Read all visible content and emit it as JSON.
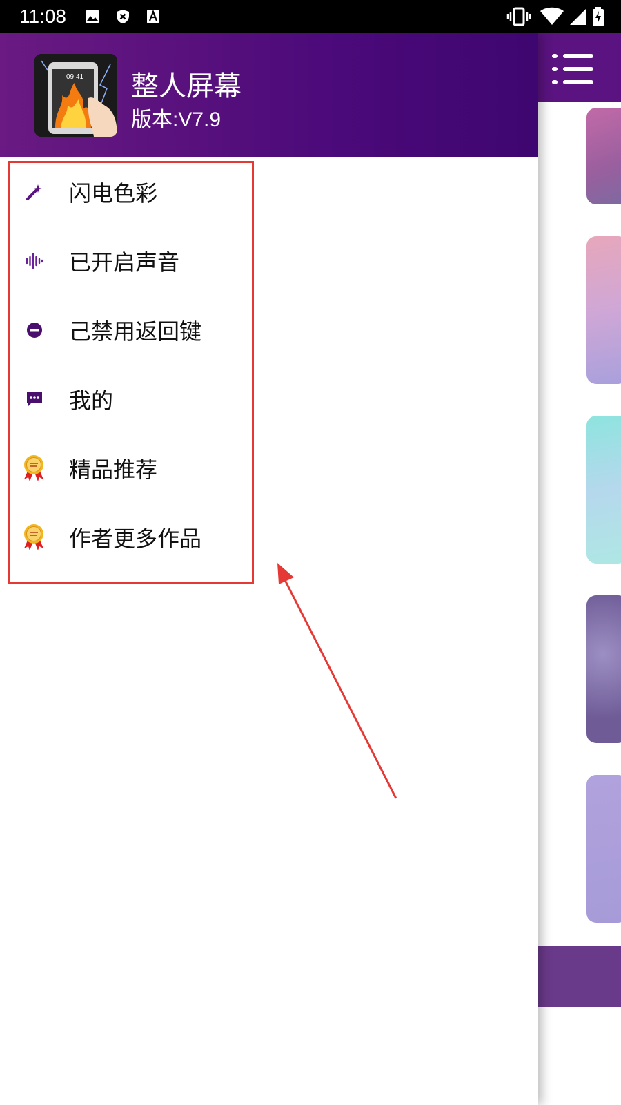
{
  "status_bar": {
    "time": "11:08",
    "icons_left": [
      "image-icon",
      "shield-x-icon",
      "font-a-icon"
    ],
    "icons_right": [
      "vibrate-icon",
      "wifi-icon",
      "signal-icon",
      "battery-charging-icon"
    ]
  },
  "drawer": {
    "header": {
      "title": "整人屏幕",
      "version": "版本:V7.9",
      "gradient": [
        "#6a1a82",
        "#3e0670"
      ]
    },
    "items": [
      {
        "label": "闪电色彩",
        "icon": "magic-wand-icon"
      },
      {
        "label": "已开启声音",
        "icon": "sound-wave-icon"
      },
      {
        "label": "己禁用返回键",
        "icon": "minus-circle-icon"
      },
      {
        "label": "我的",
        "icon": "chat-bubble-icon"
      },
      {
        "label": "精品推荐",
        "icon": "award-badge-icon"
      },
      {
        "label": "作者更多作品",
        "icon": "award-badge-icon"
      }
    ]
  },
  "colors": {
    "accent": "#5a1380",
    "annotation": "#e53935"
  }
}
